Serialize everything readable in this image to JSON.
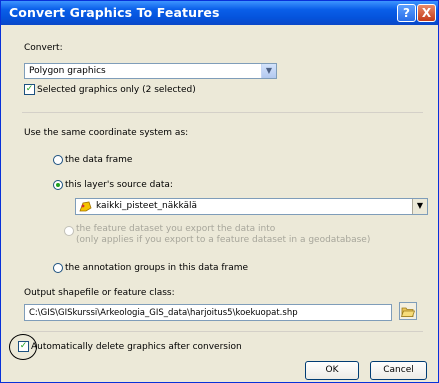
{
  "title": "Convert Graphics To Features",
  "help_glyph": "?",
  "close_glyph": "X",
  "convert_label": "Convert:",
  "convert_value": "Polygon graphics",
  "selected_only": {
    "label": "Selected graphics only  (2 selected)",
    "checked": true
  },
  "coord_label": "Use the same coordinate system as:",
  "radio_options": [
    {
      "label": "the data frame",
      "selected": false,
      "enabled": true
    },
    {
      "label": "this layer's source data:",
      "selected": true,
      "enabled": true
    },
    {
      "label": "the feature dataset you export the data into",
      "sub": "(only applies if you export to a feature dataset in a geodatabase)",
      "selected": false,
      "enabled": false
    },
    {
      "label": "the annotation groups in this data frame",
      "selected": false,
      "enabled": true
    }
  ],
  "layer_value": "kaikki_pisteet_näkkälä",
  "output_label": "Output shapefile or feature class:",
  "output_value": "C:\\GIS\\GISkurssi\\Arkeologia_GIS_data\\harjoitus5\\koekuopat.shp",
  "auto_delete": {
    "label": "Automatically delete graphics after conversion",
    "checked": true
  },
  "ok_label": "OK",
  "cancel_label": "Cancel",
  "icons": {
    "layer": "polygon-layer-icon",
    "browse": "open-folder-icon"
  }
}
